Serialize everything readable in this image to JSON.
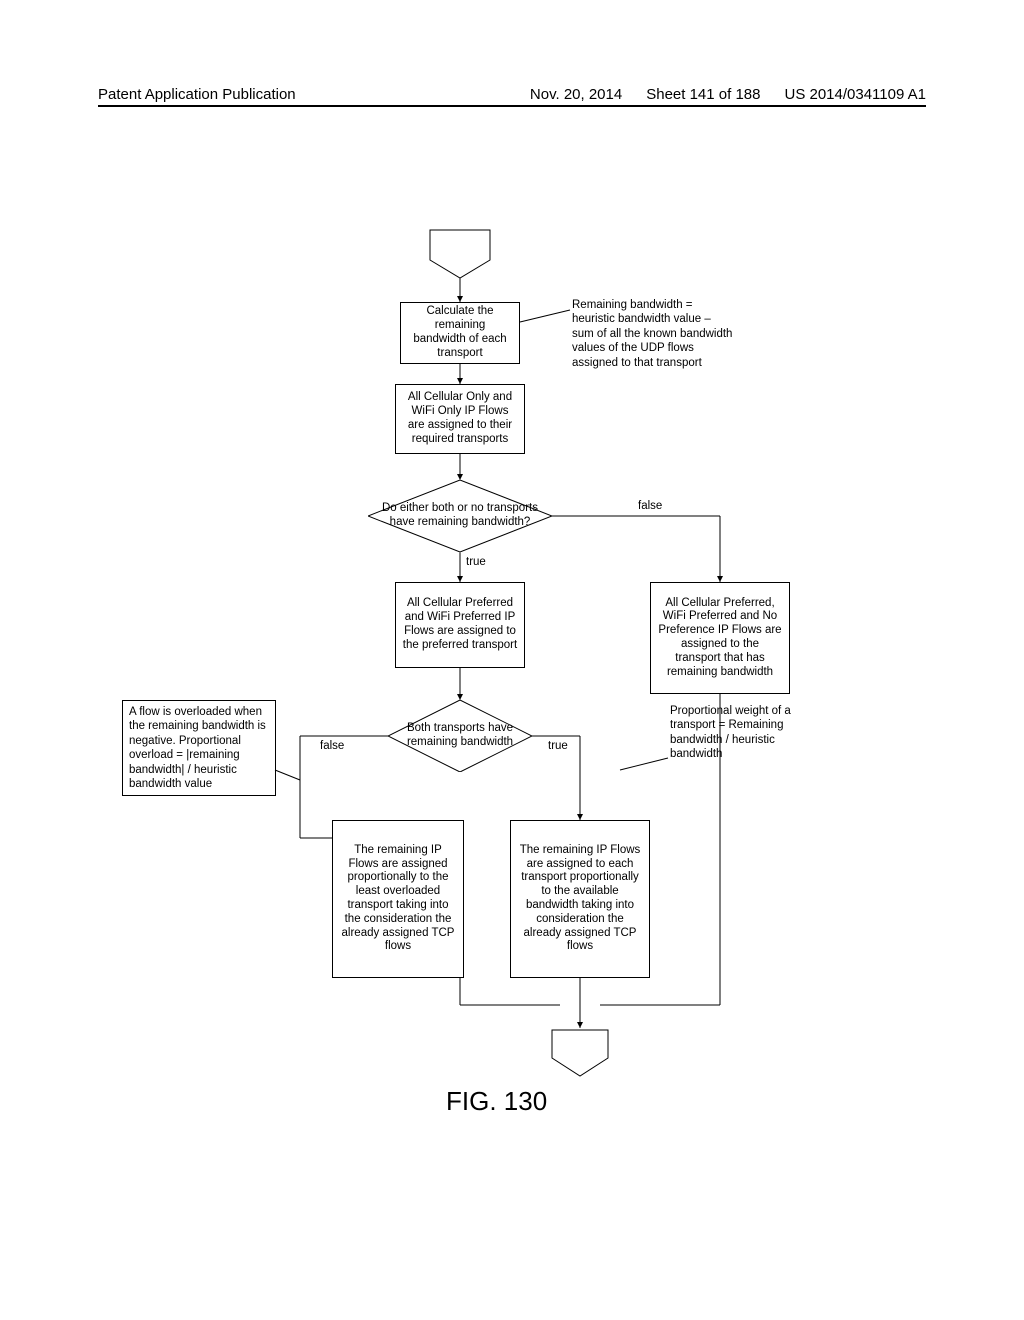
{
  "header": {
    "left": "Patent Application Publication",
    "date": "Nov. 20, 2014",
    "sheet": "Sheet 141 of 188",
    "pubno": "US 2014/0341109 A1"
  },
  "figure_label": "FIG. 130",
  "nodes": {
    "calc": "Calculate the remaining bandwidth of each transport",
    "assign_only": "All Cellular Only and WiFi Only IP Flows are assigned to their required transports",
    "decision1": "Do either both or no transports have remaining bandwidth?",
    "true_branch_box": "All Cellular Preferred and WiFi Preferred IP Flows are assigned to the preferred transport",
    "false_branch_box": "All Cellular Preferred, WiFi Preferred and No Preference IP Flows are assigned to the transport that has remaining bandwidth",
    "decision2": "Both transports have remaining bandwidth",
    "left_assign": "The remaining IP Flows are assigned proportionally to the least overloaded transport taking into the consideration the already assigned TCP flows",
    "right_assign": "The remaining IP Flows are assigned to each transport proportionally to the available bandwidth taking into consideration the already assigned TCP flows"
  },
  "annotations": {
    "remaining_bw": "Remaining bandwidth = heuristic bandwidth value – sum of all the known bandwidth values of the UDP flows assigned to that transport",
    "overload_note": "A flow is overloaded when the remaining bandwidth is negative. Proportional overload = |remaining bandwidth| / heuristic bandwidth value",
    "prop_weight": "Proportional weight of a transport = Remaining bandwidth / heuristic bandwidth"
  },
  "labels": {
    "true": "true",
    "false": "false",
    "false2": "false",
    "true2": "true"
  }
}
